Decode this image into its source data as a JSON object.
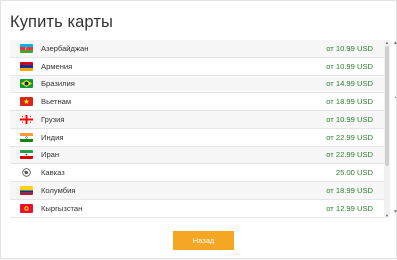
{
  "dialog": {
    "title": "Купить карты",
    "back_label": "Назад"
  },
  "countries": [
    {
      "name": "Азербайджан",
      "price": "от 10.99 USD",
      "flag": "azerbaijan-flag-icon"
    },
    {
      "name": "Армения",
      "price": "от 10.99 USD",
      "flag": "armenia-flag-icon"
    },
    {
      "name": "Бразилия",
      "price": "от 14.99 USD",
      "flag": "brazil-flag-icon"
    },
    {
      "name": "Вьетнам",
      "price": "от 18.99 USD",
      "flag": "vietnam-flag-icon"
    },
    {
      "name": "Грузия",
      "price": "от 10.99 USD",
      "flag": "georgia-flag-icon"
    },
    {
      "name": "Индия",
      "price": "от 22.99 USD",
      "flag": "india-flag-icon"
    },
    {
      "name": "Иран",
      "price": "от 22.99 USD",
      "flag": "iran-flag-icon"
    },
    {
      "name": "Кавказ",
      "price": "25.00 USD",
      "flag": "globe-icon"
    },
    {
      "name": "Колумбия",
      "price": "от 18.99 USD",
      "flag": "colombia-flag-icon"
    },
    {
      "name": "Кыргызстан",
      "price": "от 12.99 USD",
      "flag": "kyrgyzstan-flag-icon"
    }
  ],
  "colors": {
    "price": "#2e7d32",
    "button": "#f5a623",
    "row_alt": "#f7f7f7"
  }
}
